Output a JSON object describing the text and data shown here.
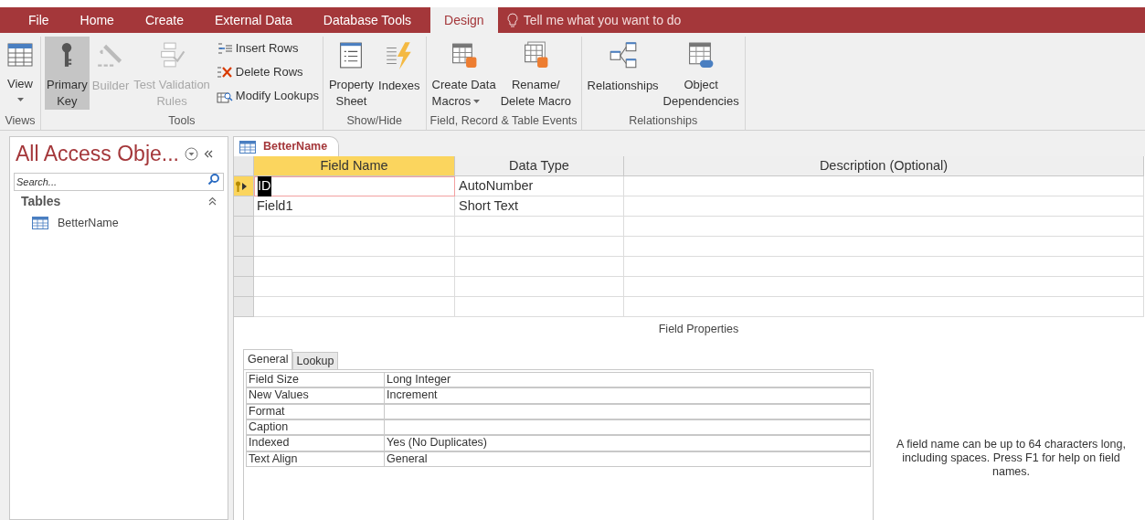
{
  "ribbon_tabs": [
    {
      "label": "File",
      "selected": false
    },
    {
      "label": "Home",
      "selected": false
    },
    {
      "label": "Create",
      "selected": false
    },
    {
      "label": "External Data",
      "selected": false
    },
    {
      "label": "Database Tools",
      "selected": false
    },
    {
      "label": "Design",
      "selected": true
    }
  ],
  "tell_me": {
    "placeholder": "Tell me what you want to do"
  },
  "ribbon_groups": [
    {
      "label": "Views",
      "buttons": [
        {
          "kind": "large",
          "lines": [
            "View"
          ],
          "dropdown": true,
          "active": false,
          "disabled": false
        }
      ]
    },
    {
      "label": "Tools",
      "buttons": [
        {
          "kind": "large",
          "lines": [
            "Primary",
            "Key"
          ],
          "dropdown": false,
          "active": true,
          "disabled": false
        },
        {
          "kind": "large",
          "lines": [
            "Builder"
          ],
          "dropdown": false,
          "active": false,
          "disabled": true
        },
        {
          "kind": "large",
          "lines": [
            "Test Validation",
            "Rules"
          ],
          "dropdown": false,
          "active": false,
          "disabled": true
        },
        {
          "kind": "small",
          "lines": [
            "Insert Rows"
          ],
          "dropdown": false,
          "active": false,
          "disabled": false
        },
        {
          "kind": "small",
          "lines": [
            "Delete Rows"
          ],
          "dropdown": false,
          "active": false,
          "disabled": false
        },
        {
          "kind": "small",
          "lines": [
            "Modify Lookups"
          ],
          "dropdown": false,
          "active": false,
          "disabled": false
        }
      ]
    },
    {
      "label": "Show/Hide",
      "buttons": [
        {
          "kind": "large",
          "lines": [
            "Property",
            "Sheet"
          ],
          "dropdown": false,
          "active": false,
          "disabled": false
        },
        {
          "kind": "large",
          "lines": [
            "Indexes"
          ],
          "dropdown": false,
          "active": false,
          "disabled": false
        }
      ]
    },
    {
      "label": "Field, Record & Table Events",
      "buttons": [
        {
          "kind": "large",
          "lines": [
            "Create Data",
            "Macros"
          ],
          "dropdown": true,
          "active": false,
          "disabled": false
        },
        {
          "kind": "large",
          "lines": [
            "Rename/",
            "Delete Macro"
          ],
          "dropdown": false,
          "active": false,
          "disabled": false
        }
      ]
    },
    {
      "label": "Relationships",
      "buttons": [
        {
          "kind": "large",
          "lines": [
            "Relationships"
          ],
          "dropdown": false,
          "active": false,
          "disabled": false
        },
        {
          "kind": "large",
          "lines": [
            "Object",
            "Dependencies"
          ],
          "dropdown": false,
          "active": false,
          "disabled": false
        }
      ]
    }
  ],
  "nav_pane": {
    "title": "All Access Obje...",
    "search": {
      "placeholder": "Search..."
    },
    "section": "Tables",
    "items": [
      "BetterName"
    ]
  },
  "document_tab": {
    "label": "BetterName"
  },
  "design_grid": {
    "columns": [
      "Field Name",
      "Data Type",
      "Description (Optional)"
    ],
    "rows": [
      {
        "field_name": "ID",
        "data_type": "AutoNumber",
        "primary_key": true,
        "selected": true
      },
      {
        "field_name": "Field1",
        "data_type": "Short Text",
        "primary_key": false,
        "selected": false
      }
    ]
  },
  "field_properties": {
    "title": "Field Properties",
    "tabs": [
      {
        "label": "General",
        "selected": true
      },
      {
        "label": "Lookup",
        "selected": false
      }
    ],
    "rows": [
      {
        "label": "Field Size",
        "value": "Long Integer"
      },
      {
        "label": "New Values",
        "value": "Increment"
      },
      {
        "label": "Format",
        "value": ""
      },
      {
        "label": "Caption",
        "value": ""
      },
      {
        "label": "Indexed",
        "value": "Yes (No Duplicates)"
      },
      {
        "label": "Text Align",
        "value": "General"
      }
    ],
    "help": "A field name can be up to 64 characters long, including spaces. Press F1 for help on field names."
  }
}
